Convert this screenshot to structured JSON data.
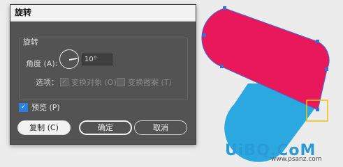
{
  "dialog": {
    "title": "旋转",
    "group_title": "旋转",
    "angle_label": "角度 (A):",
    "angle_value": "10°",
    "options_label": "选项：",
    "option_objects": "变换对象 (O)",
    "option_patterns": "变换图案 (T)",
    "option_objects_checked": true,
    "option_patterns_checked": false,
    "preview_label": "预览 (P)",
    "preview_checked": true,
    "copy_button": "复制 (C)",
    "ok_button": "确定",
    "cancel_button": "取消"
  },
  "colors": {
    "shape_pink": "#e8185b",
    "shape_blue": "#2ca8e0",
    "selection_blue": "#3b6fd6",
    "highlight_box": "#f2c200",
    "dialog_bg": "#535353",
    "checkbox_blue": "#2b7fe0"
  },
  "watermark": {
    "logo": "UiBQ.CoM",
    "url": "www.psanz.com"
  }
}
